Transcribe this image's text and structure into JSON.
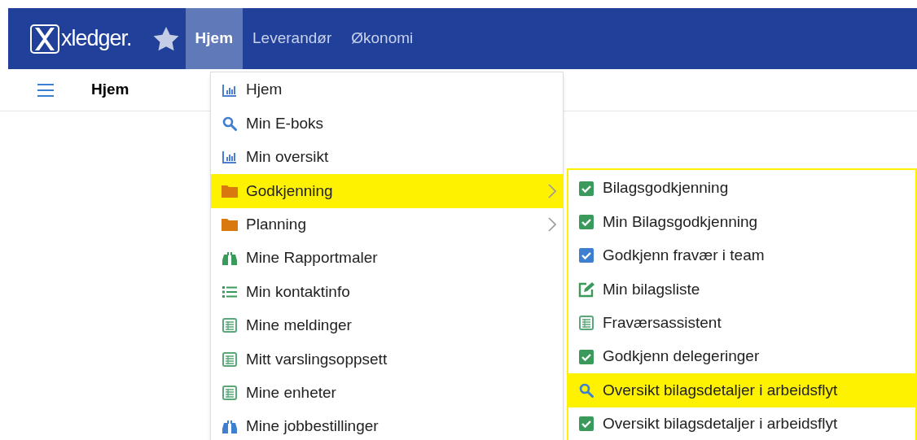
{
  "app": {
    "logo_text": "xledger."
  },
  "nav": [
    {
      "label": "Hjem",
      "selected": true
    },
    {
      "label": "Leverandør",
      "selected": false
    },
    {
      "label": "Økonomi",
      "selected": false
    }
  ],
  "page_title": "Hjem",
  "menu": [
    {
      "label": "Hjem",
      "kind": "chart",
      "color": "#4a7fd4",
      "selected": false,
      "has_submenu": false
    },
    {
      "label": "Min E-boks",
      "kind": "search",
      "color": "#3f7fd0",
      "selected": false,
      "has_submenu": false
    },
    {
      "label": "Min oversikt",
      "kind": "chart",
      "color": "#4a7fd4",
      "selected": false,
      "has_submenu": false
    },
    {
      "label": "Godkjenning",
      "kind": "folder",
      "color": "#d9780f",
      "selected": true,
      "has_submenu": true
    },
    {
      "label": "Planning",
      "kind": "folder",
      "color": "#d9780f",
      "selected": false,
      "has_submenu": true
    },
    {
      "label": "Mine Rapportmaler",
      "kind": "binoculars",
      "color": "#3a9a5b",
      "selected": false,
      "has_submenu": false
    },
    {
      "label": "Min kontaktinfo",
      "kind": "list",
      "color": "#3a9a5b",
      "selected": false,
      "has_submenu": false
    },
    {
      "label": "Mine meldinger",
      "kind": "table",
      "color": "#5aa87a",
      "selected": false,
      "has_submenu": false
    },
    {
      "label": "Mitt varslingsoppsett",
      "kind": "table",
      "color": "#5aa87a",
      "selected": false,
      "has_submenu": false
    },
    {
      "label": "Mine enheter",
      "kind": "table",
      "color": "#5aa87a",
      "selected": false,
      "has_submenu": false
    },
    {
      "label": "Mine jobbestillinger",
      "kind": "binoculars",
      "color": "#3f7fd0",
      "selected": false,
      "has_submenu": false
    }
  ],
  "submenu": [
    {
      "label": "Bilagsgodkjenning",
      "kind": "check",
      "color": "#3a9a5b",
      "selected": false
    },
    {
      "label": "Min Bilagsgodkjenning",
      "kind": "check",
      "color": "#3a9a5b",
      "selected": false
    },
    {
      "label": "Godkjenn fravær i team",
      "kind": "check",
      "color": "#3f7fd0",
      "selected": false
    },
    {
      "label": "Min bilagsliste",
      "kind": "edit",
      "color": "#3a9a5b",
      "selected": false
    },
    {
      "label": "Fraværsassistent",
      "kind": "table",
      "color": "#5aa87a",
      "selected": false
    },
    {
      "label": "Godkjenn delegeringer",
      "kind": "check",
      "color": "#3a9a5b",
      "selected": false
    },
    {
      "label": "Oversikt bilagsdetaljer i arbeidsflyt",
      "kind": "search",
      "color": "#3f7fd0",
      "selected": true
    },
    {
      "label": "Oversikt bilagsdetaljer i arbeidsflyt",
      "kind": "check",
      "color": "#3a9a5b",
      "selected": false
    }
  ]
}
